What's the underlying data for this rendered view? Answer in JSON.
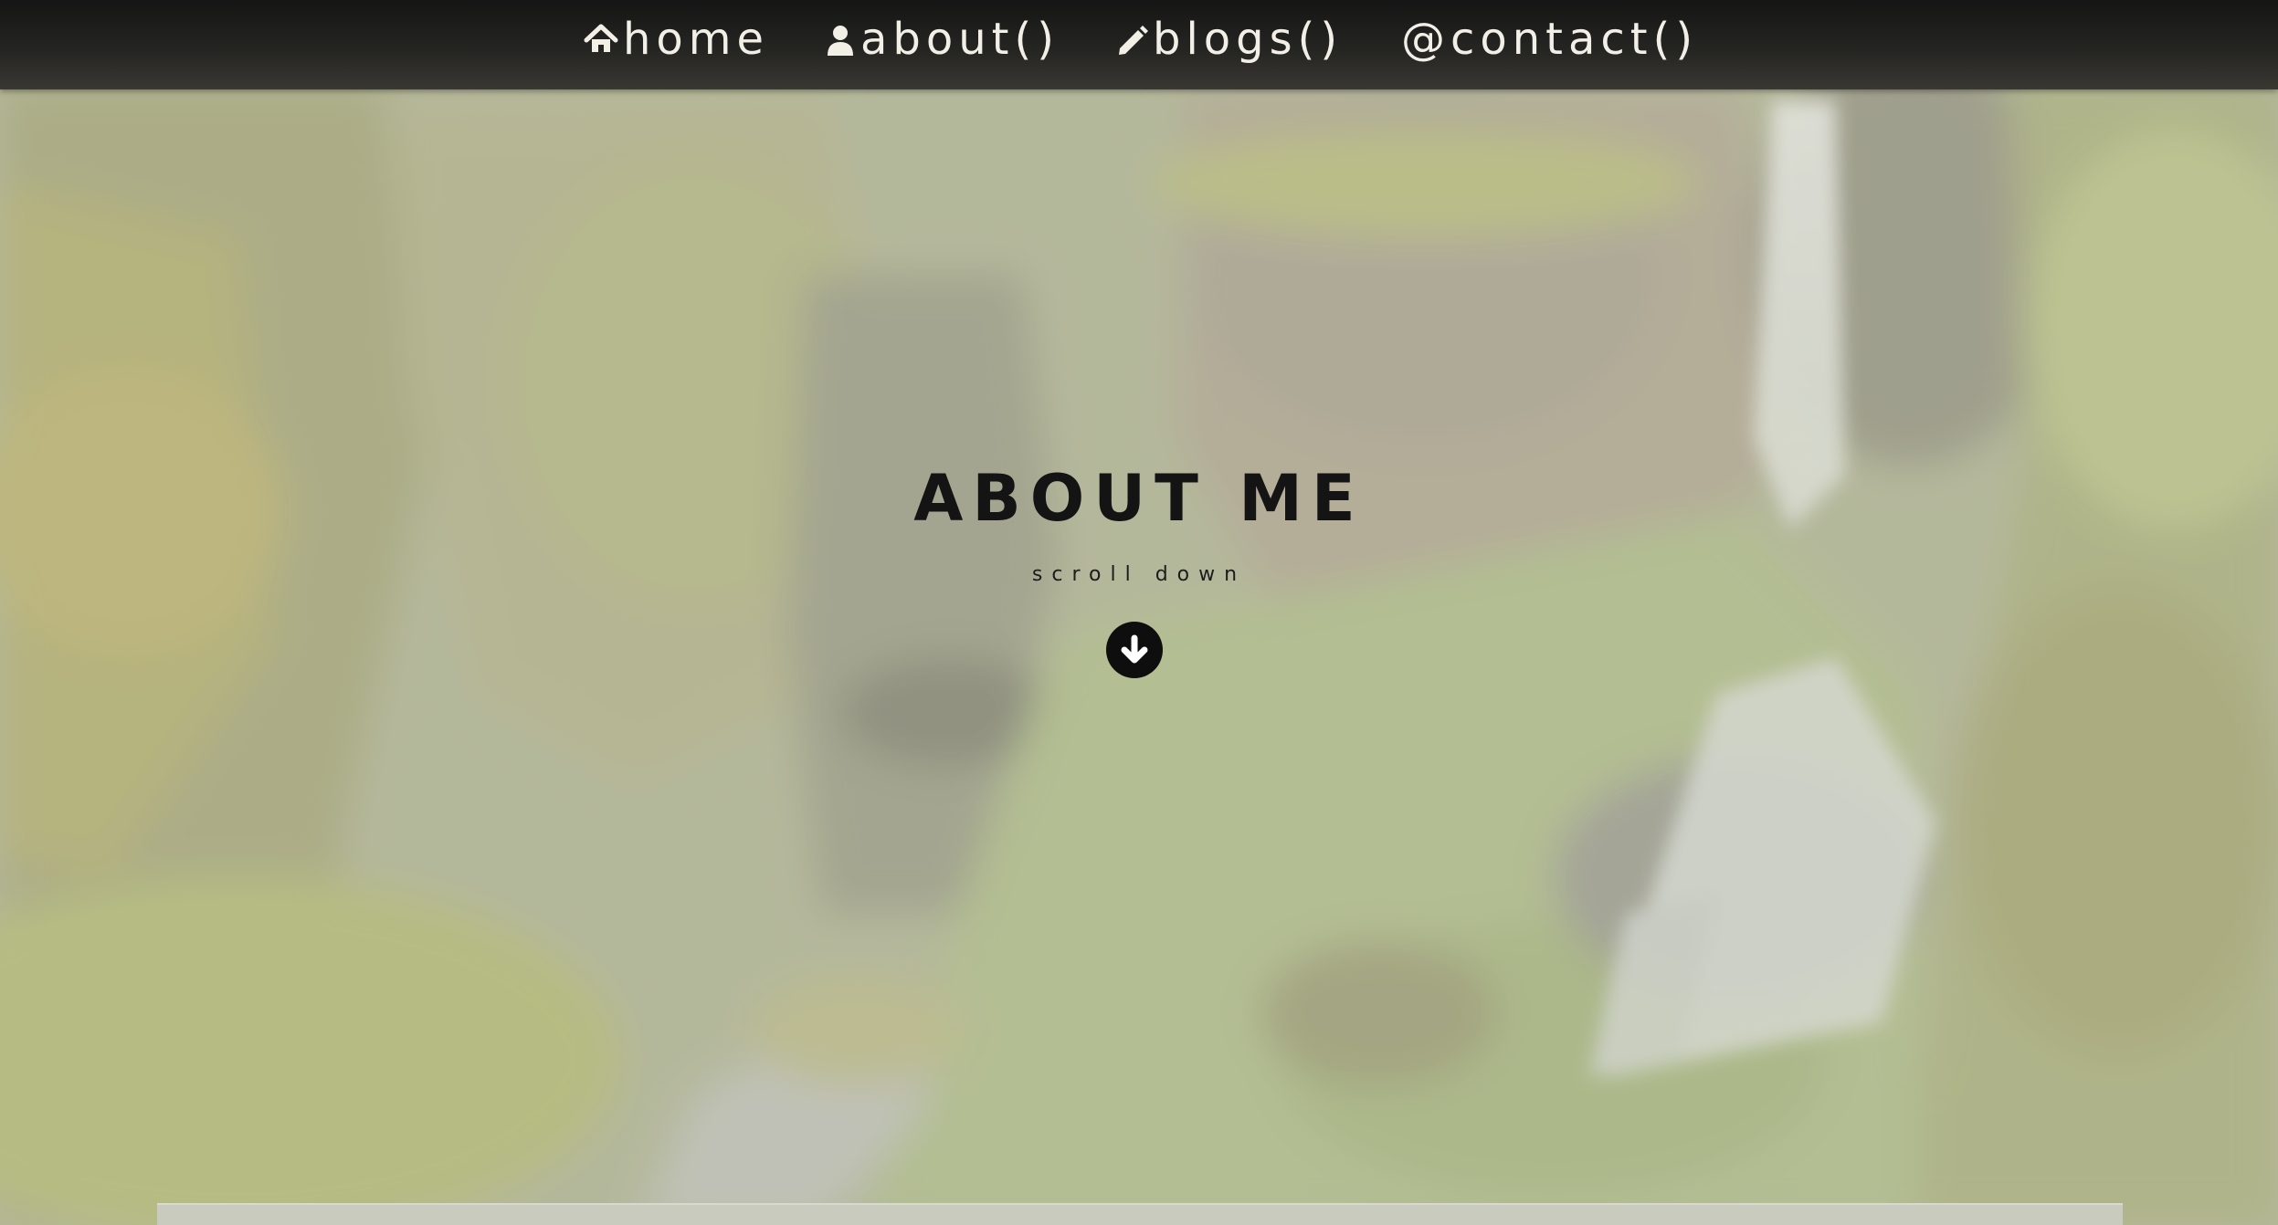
{
  "navbar": {
    "items": [
      {
        "label": "home",
        "icon": "home-icon"
      },
      {
        "label": "about()",
        "icon": "user-icon"
      },
      {
        "label": "blogs()",
        "icon": "pencil-icon"
      },
      {
        "label": "@contact()",
        "icon": ""
      }
    ]
  },
  "hero": {
    "title": "ABOUT ME",
    "scroll_label": "scroll down",
    "scroll_icon": "arrow-down-circle-icon",
    "background": "mossy-canyon-waterfall"
  },
  "colors": {
    "navbar": "#1e1e1c",
    "nav_text": "#f2efe6",
    "title_text": "#141414",
    "overlay": "#c8cbb6"
  }
}
